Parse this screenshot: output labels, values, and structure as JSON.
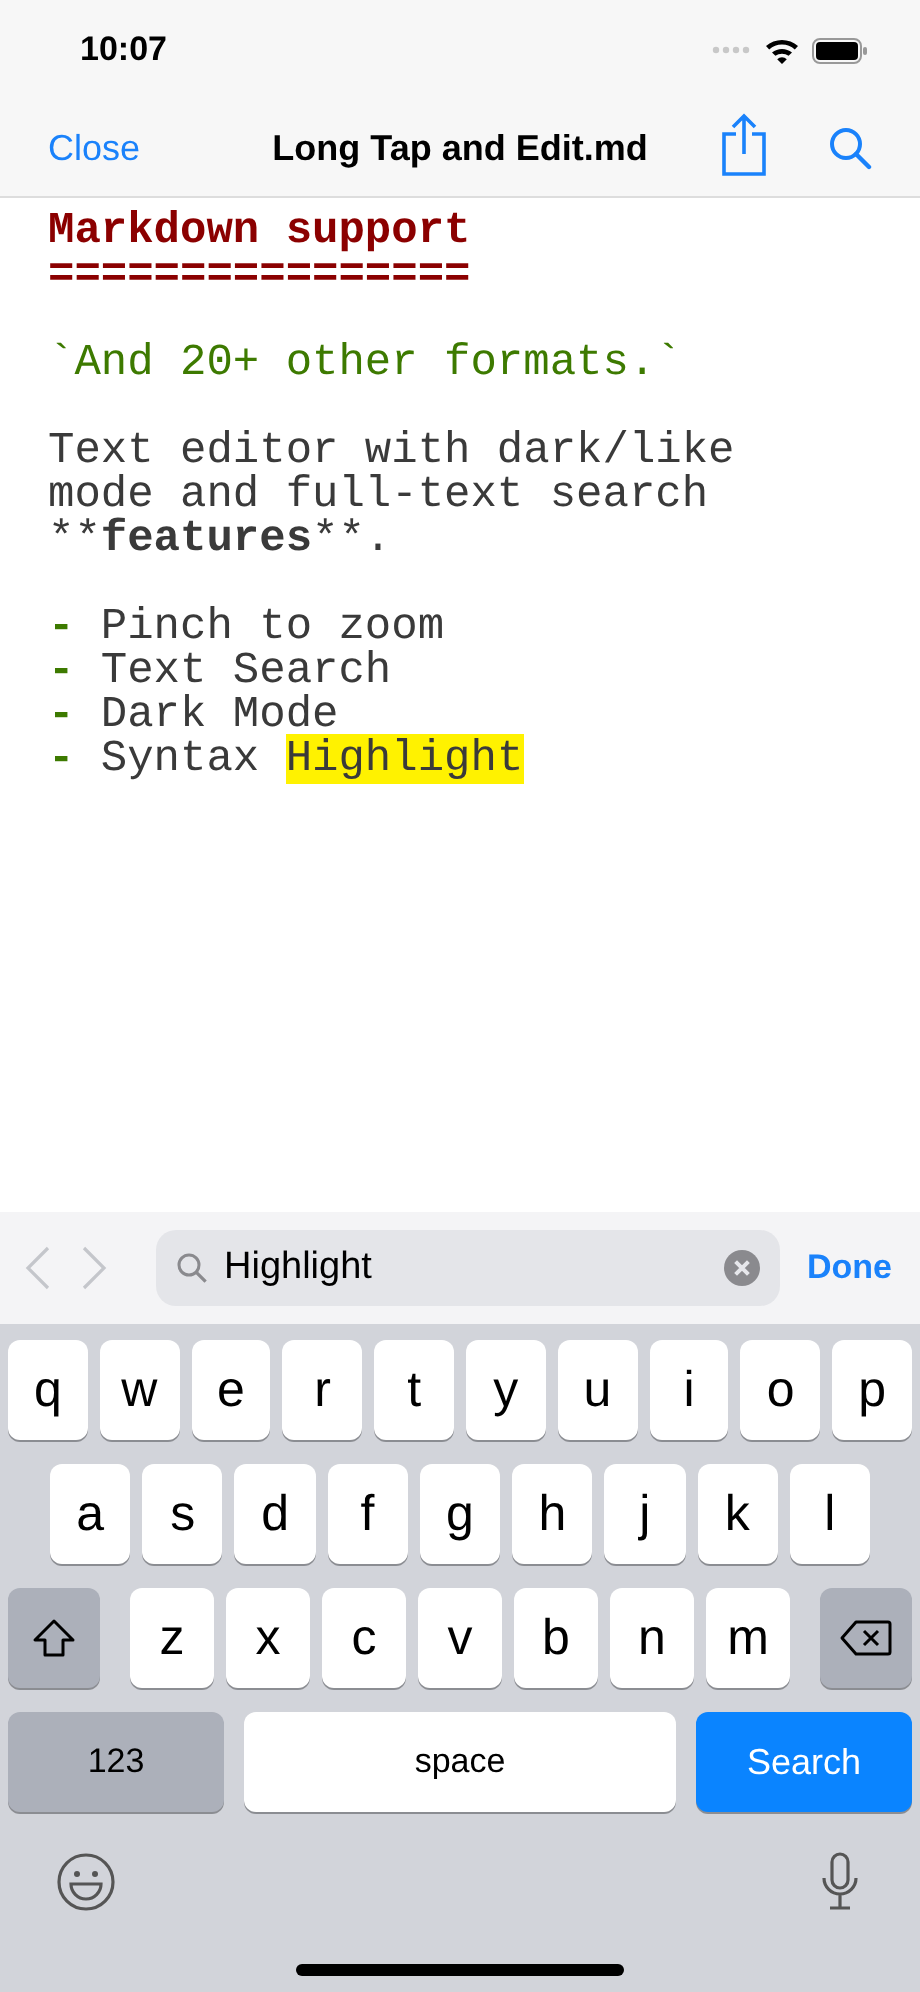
{
  "status_bar": {
    "time": "10:07"
  },
  "nav": {
    "close": "Close",
    "title": "Long Tap and Edit.md"
  },
  "editor": {
    "blocks": [
      {
        "lines": [
          {
            "segments": [
              {
                "text": "Markdown support",
                "kind": "heading"
              }
            ]
          },
          {
            "segments": [
              {
                "text": "================",
                "kind": "heading"
              }
            ]
          }
        ]
      },
      {
        "lines": [
          {
            "segments": [
              {
                "text": "`And 20+ other formats.`",
                "kind": "code"
              }
            ]
          }
        ]
      },
      {
        "lines": [
          {
            "segments": [
              {
                "text": "Text editor with dark/like",
                "kind": "plain"
              }
            ]
          },
          {
            "segments": [
              {
                "text": "mode and full-text search",
                "kind": "plain"
              }
            ]
          },
          {
            "segments": [
              {
                "text": "**",
                "kind": "plain"
              },
              {
                "text": "features",
                "kind": "bold"
              },
              {
                "text": "**.",
                "kind": "plain"
              }
            ]
          }
        ]
      },
      {
        "lines": [
          {
            "segments": [
              {
                "text": "-",
                "kind": "bullet"
              },
              {
                "text": " Pinch to zoom",
                "kind": "plain"
              }
            ]
          },
          {
            "segments": [
              {
                "text": "-",
                "kind": "bullet"
              },
              {
                "text": " Text Search",
                "kind": "plain"
              }
            ]
          },
          {
            "segments": [
              {
                "text": "-",
                "kind": "bullet"
              },
              {
                "text": " Dark Mode",
                "kind": "plain"
              }
            ]
          },
          {
            "segments": [
              {
                "text": "-",
                "kind": "bullet"
              },
              {
                "text": " Syntax ",
                "kind": "plain"
              },
              {
                "text": "Highlight",
                "kind": "highlight"
              }
            ]
          }
        ]
      }
    ]
  },
  "find_bar": {
    "prev_disabled": true,
    "next_disabled": true,
    "value": "Highlight",
    "done": "Done"
  },
  "keyboard": {
    "rows": [
      {
        "keys": [
          {
            "kind": "letter",
            "label": "q"
          },
          {
            "kind": "letter",
            "label": "w"
          },
          {
            "kind": "letter",
            "label": "e"
          },
          {
            "kind": "letter",
            "label": "r"
          },
          {
            "kind": "letter",
            "label": "t"
          },
          {
            "kind": "letter",
            "label": "y"
          },
          {
            "kind": "letter",
            "label": "u"
          },
          {
            "kind": "letter",
            "label": "i"
          },
          {
            "kind": "letter",
            "label": "o"
          },
          {
            "kind": "letter",
            "label": "p"
          }
        ]
      },
      {
        "keys": [
          {
            "kind": "letter",
            "label": "a"
          },
          {
            "kind": "letter",
            "label": "s"
          },
          {
            "kind": "letter",
            "label": "d"
          },
          {
            "kind": "letter",
            "label": "f"
          },
          {
            "kind": "letter",
            "label": "g"
          },
          {
            "kind": "letter",
            "label": "h"
          },
          {
            "kind": "letter",
            "label": "j"
          },
          {
            "kind": "letter",
            "label": "k"
          },
          {
            "kind": "letter",
            "label": "l"
          }
        ]
      },
      {
        "keys": [
          {
            "kind": "shift"
          },
          {
            "kind": "letter",
            "label": "z"
          },
          {
            "kind": "letter",
            "label": "x"
          },
          {
            "kind": "letter",
            "label": "c"
          },
          {
            "kind": "letter",
            "label": "v"
          },
          {
            "kind": "letter",
            "label": "b"
          },
          {
            "kind": "letter",
            "label": "n"
          },
          {
            "kind": "letter",
            "label": "m"
          },
          {
            "kind": "delete"
          }
        ]
      },
      {
        "keys": [
          {
            "kind": "mode",
            "label": "123"
          },
          {
            "kind": "space",
            "label": "space"
          },
          {
            "kind": "search",
            "label": "Search"
          }
        ]
      }
    ]
  }
}
